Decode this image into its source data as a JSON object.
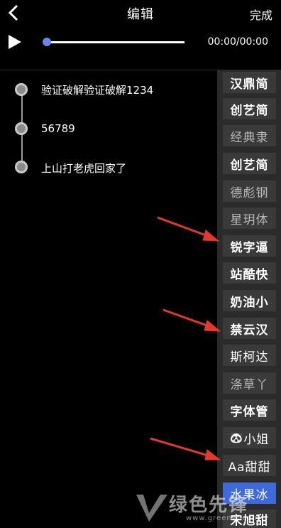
{
  "header": {
    "title": "编辑",
    "done_label": "完成"
  },
  "player": {
    "time_display": "00:00/00:00",
    "progress": 0.0
  },
  "subtitles": [
    {
      "text": "验证破解验证破解1234"
    },
    {
      "text": "56789"
    },
    {
      "text": "上山打老虎回家了"
    }
  ],
  "font_panel": {
    "fonts": [
      {
        "label": "汉鼎简"
      },
      {
        "label": "创艺简"
      },
      {
        "label": "经典隶"
      },
      {
        "label": "创艺简"
      },
      {
        "label": "德彪钢"
      },
      {
        "label": "星玥体"
      },
      {
        "label": "锐字逼"
      },
      {
        "label": "站酷快"
      },
      {
        "label": "奶油小"
      },
      {
        "label": "禁云汉"
      },
      {
        "label": "斯柯达"
      },
      {
        "label": "涤草丫"
      },
      {
        "label": "字体管"
      },
      {
        "label": "小姐"
      },
      {
        "label": "Aa甜甜"
      },
      {
        "label": "水果冰"
      },
      {
        "label": "宋旭甜"
      }
    ],
    "selected_index": 15
  },
  "watermark": {
    "brand": "绿色先锋",
    "url": "www.greenxf.com"
  },
  "colors": {
    "accent": "#3e6bd8",
    "arrow": "#e03a2f",
    "knob": "#6a86e8"
  }
}
